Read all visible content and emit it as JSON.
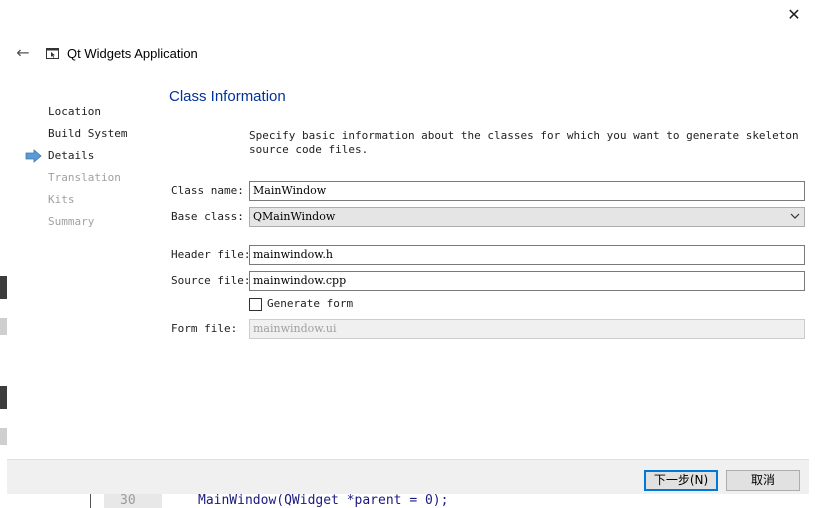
{
  "window": {
    "title": "Qt Widgets Application",
    "close_glyph": "✕",
    "back_glyph": "←",
    "back_icon": "arrow-left-icon",
    "close_icon": "close-icon",
    "app_icon": "window-cursor-icon"
  },
  "steps": [
    {
      "label": "Location",
      "state": "done"
    },
    {
      "label": "Build System",
      "state": "done"
    },
    {
      "label": "Details",
      "state": "current"
    },
    {
      "label": "Translation",
      "state": "pending"
    },
    {
      "label": "Kits",
      "state": "pending"
    },
    {
      "label": "Summary",
      "state": "pending"
    }
  ],
  "page": {
    "title": "Class Information",
    "description": "Specify basic information about the classes for which you want to generate skeleton source code files."
  },
  "form": {
    "class_name": {
      "label": "Class name:",
      "value": "MainWindow"
    },
    "base_class": {
      "label": "Base class:",
      "value": "QMainWindow"
    },
    "header_file": {
      "label": "Header file:",
      "value": "mainwindow.h"
    },
    "source_file": {
      "label": "Source file:",
      "value": "mainwindow.cpp"
    },
    "generate_form": {
      "label": "Generate form",
      "checked": false
    },
    "form_file": {
      "label": "Form file:",
      "value": "mainwindow.ui"
    }
  },
  "buttons": {
    "next": "下一步(N)",
    "cancel": "取消"
  },
  "background": {
    "line_number": "30",
    "code": "MainWindow(QWidget *parent = 0);"
  },
  "colors": {
    "title_blue": "#003399",
    "step_arrow": "#5b9bd5",
    "default_button_border": "#0078d7"
  }
}
